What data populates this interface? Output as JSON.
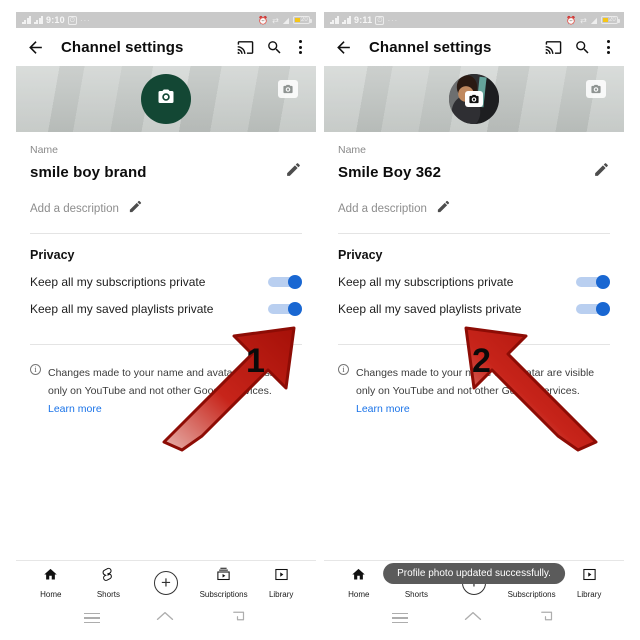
{
  "panels": [
    {
      "id": "before",
      "statusbar": {
        "time": "9:10",
        "battery_text": "20",
        "dots": "···"
      },
      "toolbar": {
        "back_icon": "back-arrow-icon",
        "title": "Channel settings",
        "cast_icon": "cast-icon",
        "search_icon": "search-icon",
        "overflow_icon": "overflow-menu-icon"
      },
      "banner": {
        "avatar_type": "placeholder",
        "avatar_camera_icon": "camera-icon",
        "banner_camera_icon": "camera-icon",
        "avatar_bg_color": "#134734"
      },
      "name_field": {
        "label": "Name",
        "value": "smile boy brand",
        "edit_icon": "pencil-icon"
      },
      "description_field": {
        "value": "Add a description",
        "edit_icon": "pencil-icon"
      },
      "privacy": {
        "title": "Privacy",
        "items": [
          {
            "label": "Keep all my subscriptions private",
            "on": true
          },
          {
            "label": "Keep all my saved playlists private",
            "on": true
          }
        ]
      },
      "info": {
        "icon": "info-icon",
        "text": "Changes made to your name and avatar are visible only on YouTube and not other Google services.",
        "link": "Learn more"
      },
      "bottom_nav": [
        {
          "label": "Home",
          "icon": "home-icon"
        },
        {
          "label": "Shorts",
          "icon": "shorts-icon"
        },
        {
          "label": "",
          "icon": "plus-icon"
        },
        {
          "label": "Subscriptions",
          "icon": "subscriptions-icon"
        },
        {
          "label": "Library",
          "icon": "library-icon"
        }
      ],
      "toast": "",
      "sysnav": {
        "recents_icon": "recents-icon",
        "home_icon": "home-nav-icon",
        "back_icon": "back-nav-icon"
      },
      "arrow": {
        "number": "1",
        "direction": "up-right",
        "color": "#c21a10"
      }
    },
    {
      "id": "after",
      "statusbar": {
        "time": "9:11",
        "battery_text": "20",
        "dots": "···"
      },
      "toolbar": {
        "back_icon": "back-arrow-icon",
        "title": "Channel settings",
        "cast_icon": "cast-icon",
        "search_icon": "search-icon",
        "overflow_icon": "overflow-menu-icon"
      },
      "banner": {
        "avatar_type": "photo",
        "avatar_camera_icon": "camera-icon",
        "banner_camera_icon": "camera-icon",
        "avatar_bg_color": "#3a3a3a"
      },
      "name_field": {
        "label": "Name",
        "value": "Smile Boy 362",
        "edit_icon": "pencil-icon"
      },
      "description_field": {
        "value": "Add a description",
        "edit_icon": "pencil-icon"
      },
      "privacy": {
        "title": "Privacy",
        "items": [
          {
            "label": "Keep all my subscriptions private",
            "on": true
          },
          {
            "label": "Keep all my saved playlists private",
            "on": true
          }
        ]
      },
      "info": {
        "icon": "info-icon",
        "text": "Changes made to your name and avatar are visible only on YouTube and not other Google services.",
        "link": "Learn more"
      },
      "bottom_nav": [
        {
          "label": "Home",
          "icon": "home-icon"
        },
        {
          "label": "Shorts",
          "icon": "shorts-icon"
        },
        {
          "label": "",
          "icon": "plus-icon"
        },
        {
          "label": "Subscriptions",
          "icon": "subscriptions-icon"
        },
        {
          "label": "Library",
          "icon": "library-icon"
        }
      ],
      "toast": "Profile photo updated successfully.",
      "sysnav": {
        "recents_icon": "recents-icon",
        "home_icon": "home-nav-icon",
        "back_icon": "back-nav-icon"
      },
      "arrow": {
        "number": "2",
        "direction": "up-left",
        "color": "#c21a10"
      }
    }
  ],
  "colors": {
    "toggle_on": "#1967d2",
    "toggle_track": "#b9cff0",
    "link": "#1a73e8",
    "arrow_red": "#c21a10",
    "avatar_green": "#134734",
    "banner_gray": "#c6cbc8",
    "toast_bg": "#5b5b5b"
  }
}
